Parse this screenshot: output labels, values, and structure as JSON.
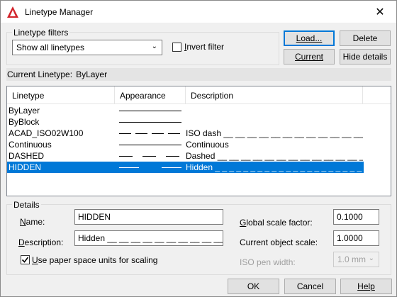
{
  "window": {
    "title": "Linetype Manager",
    "close_glyph": "✕"
  },
  "filters": {
    "group_label": "Linetype filters",
    "dropdown_value": "Show all linetypes",
    "invert_label": "Invert filter",
    "invert_checked": false
  },
  "buttons": {
    "load": "Load...",
    "delete": "Delete",
    "current": "Current",
    "hide_details": "Hide details",
    "ok": "OK",
    "cancel": "Cancel",
    "help": "Help"
  },
  "current_linetype": {
    "label": "Current Linetype:",
    "value": "ByLayer"
  },
  "list": {
    "headers": [
      "Linetype",
      "Appearance",
      "Description"
    ],
    "rows": [
      {
        "name": "ByLayer",
        "description": "",
        "pattern": "solid"
      },
      {
        "name": "ByBlock",
        "description": "",
        "pattern": "solid"
      },
      {
        "name": "ACAD_ISO02W100",
        "description": "ISO dash __ __ __ __ __ __ __ __ __ __ __ __ __",
        "pattern": "iso"
      },
      {
        "name": "Continuous",
        "description": "Continuous",
        "pattern": "solid"
      },
      {
        "name": "DASHED",
        "description": "Dashed __ __ __ __ __ __ __ __ __ __ __ __ __ __",
        "pattern": "dashed"
      },
      {
        "name": "HIDDEN",
        "description": "Hidden _ _ _ _ _ _ _ _ _ _ _ _ _ _ _ _ _ _ _ _ _ _",
        "pattern": "hidden",
        "selected": true
      }
    ]
  },
  "details": {
    "group_label": "Details",
    "name_label": "Name:",
    "name_value": "HIDDEN",
    "description_label": "Description:",
    "description_value": "Hidden __ __ __ __ __ __ __ __ __ __ __ __ __ __ .",
    "paper_space_label": "Use paper space units for scaling",
    "paper_space_checked": true,
    "global_scale_label": "Global scale factor:",
    "global_scale_value": "0.1000",
    "current_scale_label": "Current object scale:",
    "current_scale_value": "1.0000",
    "iso_pen_label": "ISO pen width:",
    "iso_pen_value": "1.0 mm"
  },
  "colors": {
    "accent": "#0078d7",
    "app_icon": "#d2232a"
  }
}
